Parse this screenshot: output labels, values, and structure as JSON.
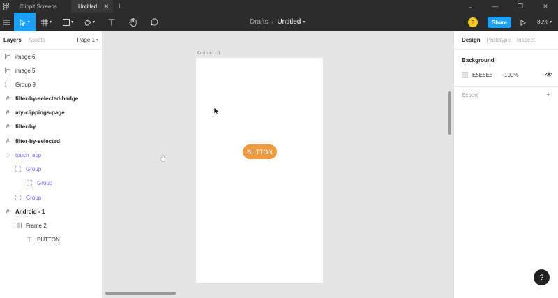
{
  "titlebar": {
    "tabs": [
      {
        "label": "Clippit Screens"
      },
      {
        "label": "Untitled"
      }
    ]
  },
  "toolbar": {
    "breadcrumb_parent": "Drafts",
    "breadcrumb_sep": "/",
    "file_title": "Untitled",
    "share_label": "Share",
    "zoom": "80%",
    "avatar_letter": "?"
  },
  "left_panel": {
    "tab_layers": "Layers",
    "tab_assets": "Assets",
    "page": "Page 1",
    "layers": [
      {
        "label": "image 6"
      },
      {
        "label": "image 5"
      },
      {
        "label": "Group 9"
      },
      {
        "label": "filter-by-selected-badge"
      },
      {
        "label": "my-clippings-page"
      },
      {
        "label": "filter-by"
      },
      {
        "label": "filter-by-selected"
      },
      {
        "label": "touch_app"
      },
      {
        "label": "Group"
      },
      {
        "label": "Group"
      },
      {
        "label": "Group"
      },
      {
        "label": "Android - 1"
      },
      {
        "label": "Frame 2"
      },
      {
        "label": "BUTTON"
      }
    ]
  },
  "canvas": {
    "frame_label": "Android - 1",
    "button_label": "BUTTON"
  },
  "right_panel": {
    "tab_design": "Design",
    "tab_prototype": "Prototype",
    "tab_inspect": "Inspect",
    "background_title": "Background",
    "background_hex": "E5E5E5",
    "background_opacity": "100%",
    "export_title": "Export",
    "help_label": "?"
  },
  "colors": {
    "accent": "#18a0fb",
    "button": "#ef9a3e",
    "chrome": "#2c2c2c",
    "canvas": "#e5e5e5"
  }
}
